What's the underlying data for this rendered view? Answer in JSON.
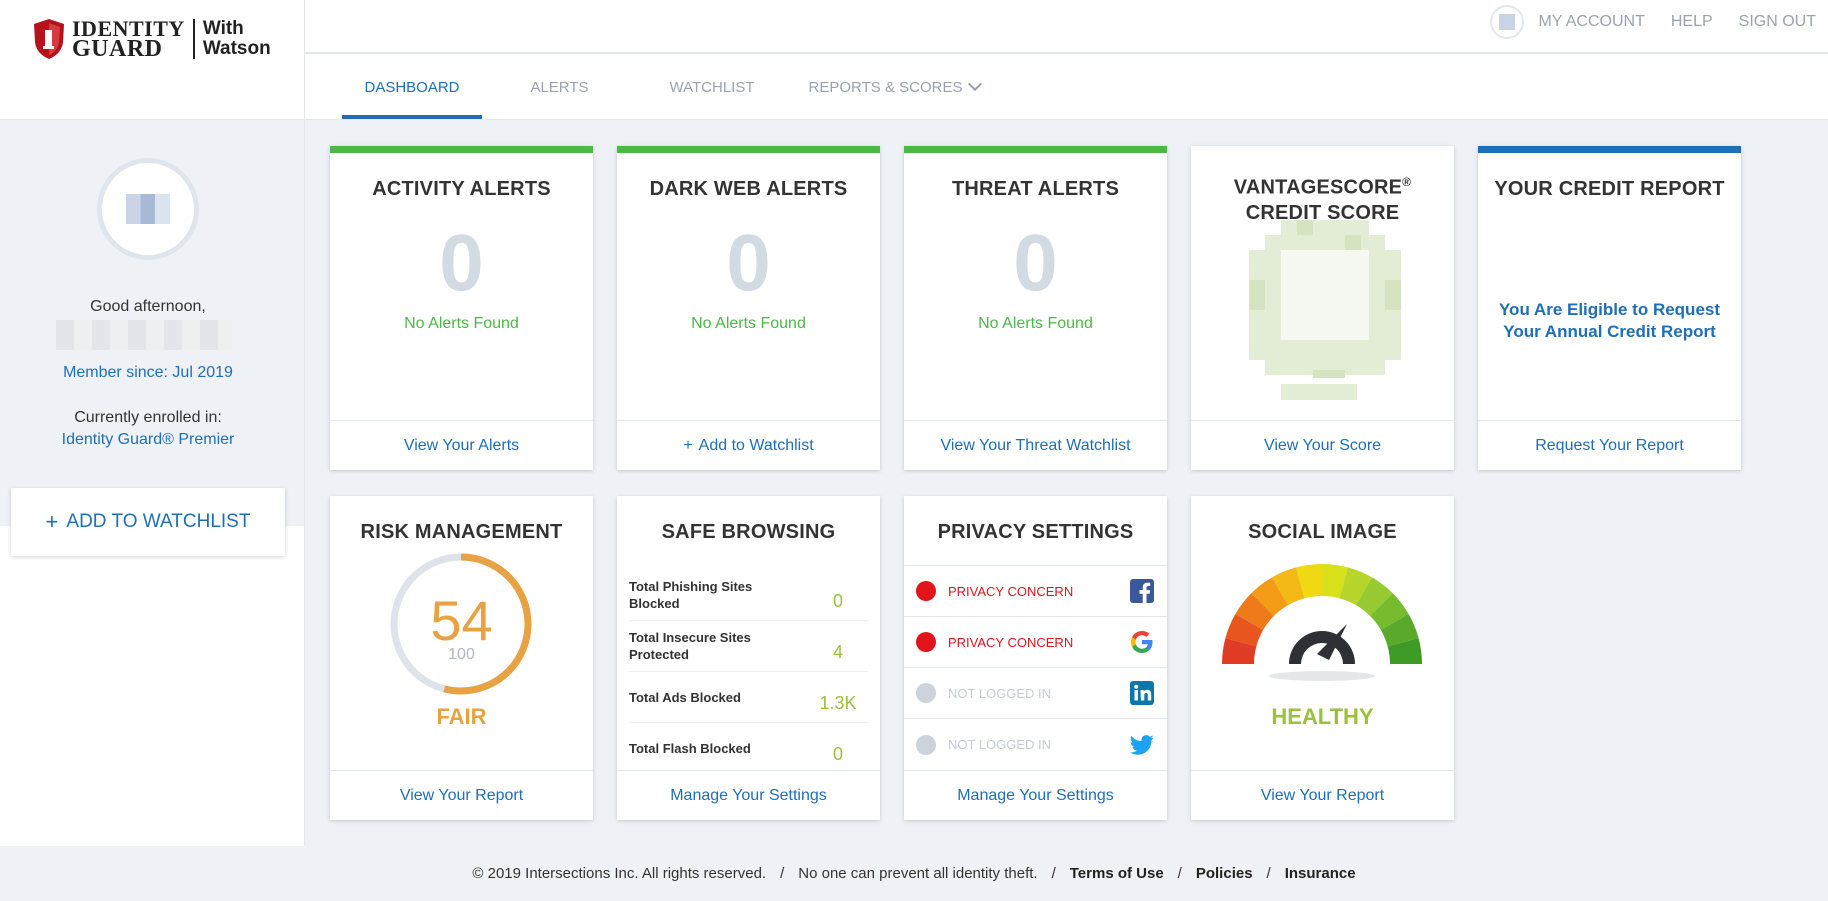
{
  "brand": {
    "line1": "IDENTITY",
    "line2": "GUARD",
    "partner": "With",
    "partner2": "Watson",
    "colors": {
      "shield": "#b5121b",
      "primary": "#1e6fb8",
      "green": "#4db848"
    }
  },
  "topnav": {
    "account": "MY ACCOUNT",
    "help": "HELP",
    "signout": "SIGN OUT"
  },
  "tabs": [
    {
      "label": "DASHBOARD",
      "active": true
    },
    {
      "label": "ALERTS"
    },
    {
      "label": "WATCHLIST"
    },
    {
      "label": "REPORTS & SCORES"
    }
  ],
  "sidebar": {
    "greeting": "Good afternoon,",
    "member_since": "Member since: Jul 2019",
    "enrolled_label": "Currently enrolled in:",
    "plan": "Identity Guard® Premier",
    "add_watchlist": "ADD TO WATCHLIST"
  },
  "cards": {
    "activity": {
      "title": "ACTIVITY ALERTS",
      "count": "0",
      "status": "No Alerts Found",
      "link": "View Your Alerts"
    },
    "darkweb": {
      "title": "DARK WEB ALERTS",
      "count": "0",
      "status": "No Alerts Found",
      "link": "Add to Watchlist"
    },
    "threat": {
      "title": "THREAT ALERTS",
      "count": "0",
      "status": "No Alerts Found",
      "link": "View Your Threat Watchlist"
    },
    "vantage": {
      "title_line1": "VANTAGESCORE",
      "reg": "®",
      "title_line2": "CREDIT SCORE",
      "link": "View Your Score"
    },
    "credit": {
      "title": "YOUR CREDIT REPORT",
      "message_line1": "You Are Eligible to Request",
      "message_line2": "Your Annual Credit Report",
      "link": "Request Your Report"
    },
    "risk": {
      "title": "RISK MANAGEMENT",
      "score": "54",
      "max": "100",
      "score_fraction": 0.54,
      "rating": "FAIR",
      "link": "View Your Report"
    },
    "safe": {
      "title": "SAFE BROWSING",
      "rows": [
        {
          "label": "Total Phishing Sites Blocked",
          "value": "0"
        },
        {
          "label": "Total Insecure Sites Protected",
          "value": "4"
        },
        {
          "label": "Total Ads Blocked",
          "value": "1.3K"
        },
        {
          "label": "Total Flash Blocked",
          "value": "0"
        }
      ],
      "link": "Manage Your Settings"
    },
    "privacy": {
      "title": "PRIVACY SETTINGS",
      "rows": [
        {
          "status": "PRIVACY CONCERN",
          "network": "facebook-icon",
          "color": "#e1141c"
        },
        {
          "status": "PRIVACY CONCERN",
          "network": "google-icon",
          "color": "#e1141c"
        },
        {
          "status": "NOT LOGGED IN",
          "network": "linkedin-icon",
          "color": "#ccd3da"
        },
        {
          "status": "NOT LOGGED IN",
          "network": "twitter-icon",
          "color": "#ccd3da"
        }
      ],
      "link": "Manage Your Settings"
    },
    "social": {
      "title": "SOCIAL IMAGE",
      "rating": "HEALTHY",
      "link": "View Your Report"
    }
  },
  "footer": {
    "copyright": "© 2019 Intersections Inc. All rights reserved.",
    "disclaimer": "No one can prevent all identity theft.",
    "terms": "Terms of Use",
    "policies": "Policies",
    "insurance": "Insurance"
  }
}
